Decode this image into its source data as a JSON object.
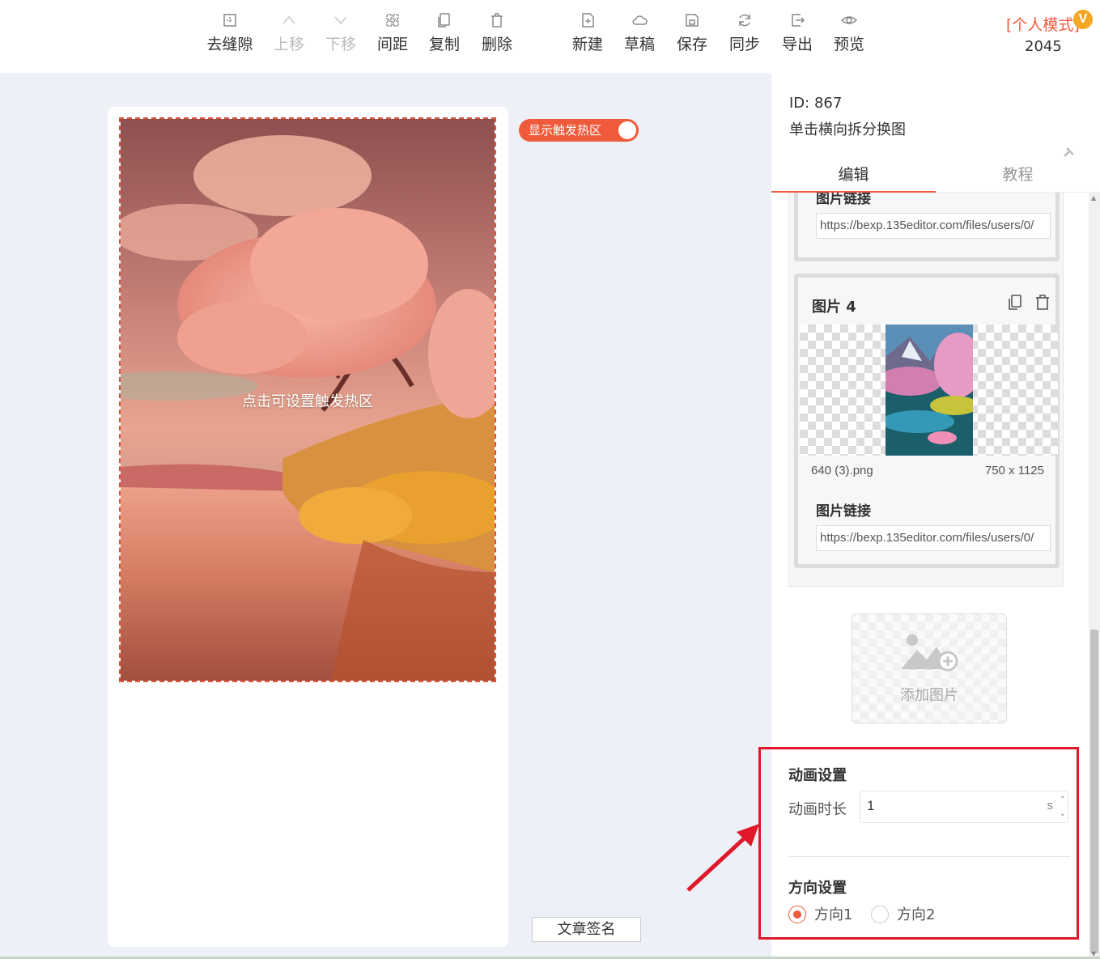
{
  "toolbar": {
    "items": [
      {
        "label": "去缝隙",
        "icon": "remove-gap-icon",
        "enabled": true
      },
      {
        "label": "上移",
        "icon": "chevron-up-icon",
        "enabled": false
      },
      {
        "label": "下移",
        "icon": "chevron-down-icon",
        "enabled": false
      },
      {
        "label": "间距",
        "icon": "spacing-icon",
        "enabled": true
      },
      {
        "label": "复制",
        "icon": "copy-icon",
        "enabled": true
      },
      {
        "label": "删除",
        "icon": "trash-icon",
        "enabled": true
      },
      {
        "label": "新建",
        "icon": "new-file-icon",
        "enabled": true
      },
      {
        "label": "草稿",
        "icon": "cloud-icon",
        "enabled": true
      },
      {
        "label": "保存",
        "icon": "save-icon",
        "enabled": true
      },
      {
        "label": "同步",
        "icon": "sync-icon",
        "enabled": true
      },
      {
        "label": "导出",
        "icon": "export-icon",
        "enabled": true
      },
      {
        "label": "预览",
        "icon": "eye-icon",
        "enabled": true
      }
    ],
    "mode_label": "[个人模式]",
    "vip_badge": "V",
    "count": "2045"
  },
  "canvas": {
    "hotspot_hint": "点击可设置触发热区",
    "toggle_label": "显示触发热区",
    "toggle_on": true,
    "signature_button": "文章签名"
  },
  "panel": {
    "id_label": "ID: 867",
    "template_name": "单击横向拆分换图",
    "tabs": [
      {
        "label": "编辑",
        "active": true
      },
      {
        "label": "教程",
        "active": false
      }
    ],
    "images": [
      {
        "link_label": "图片链接",
        "link_value": "https://bexp.135editor.com/files/users/0/"
      },
      {
        "title": "图片 4",
        "file_name": "640 (3).png",
        "dimensions": "750 x 1125",
        "link_label": "图片链接",
        "link_value": "https://bexp.135editor.com/files/users/0/"
      }
    ],
    "add_image_label": "添加图片",
    "animation": {
      "section_title": "动画设置",
      "duration_label": "动画时长",
      "duration_value": "1",
      "duration_unit": "s"
    },
    "direction": {
      "section_title": "方向设置",
      "options": [
        {
          "label": "方向1",
          "checked": true
        },
        {
          "label": "方向2",
          "checked": false
        }
      ]
    }
  },
  "colors": {
    "accent": "#ee5a3a",
    "annotation": "#e0182a",
    "background": "#eef0f7"
  }
}
